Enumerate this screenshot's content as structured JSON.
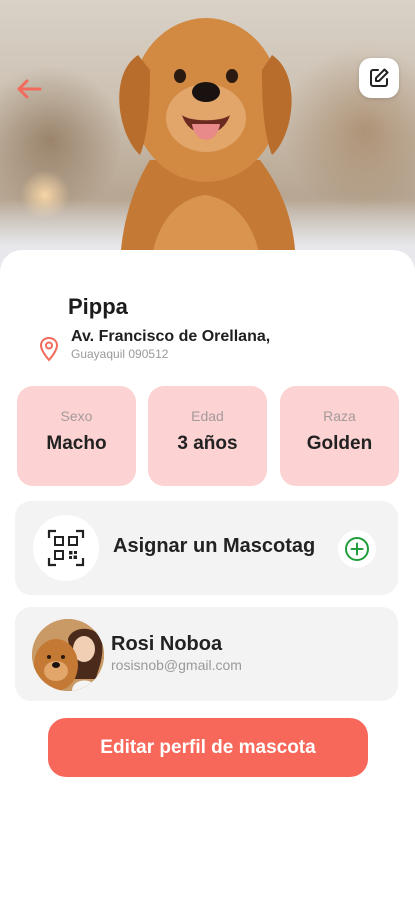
{
  "header": {
    "back_icon": "arrow-left-icon",
    "edit_icon": "edit-square-icon",
    "accent_color": "#f26a5b"
  },
  "pet": {
    "name": "Pippa",
    "address_line1": "Av. Francisco de Orellana,",
    "address_line2": "Guayaquil 090512",
    "location_icon": "location-pin-icon"
  },
  "stats": [
    {
      "label": "Sexo",
      "value": "Macho"
    },
    {
      "label": "Edad",
      "value": "3 años"
    },
    {
      "label": "Raza",
      "value": "Golden"
    }
  ],
  "mascotag": {
    "label": "Asignar un Mascotag",
    "icon": "qr-code-icon",
    "action_icon": "plus-circle-icon",
    "action_color": "#1f9d3a"
  },
  "owner": {
    "name": "Rosi Noboa",
    "email": "rosisnob@gmail.com"
  },
  "actions": {
    "edit_profile_label": "Editar perfil de mascota",
    "button_color": "#f7685b"
  },
  "colors": {
    "stat_bg": "#fcd2d2",
    "card_bg": "#f3f3f3"
  }
}
